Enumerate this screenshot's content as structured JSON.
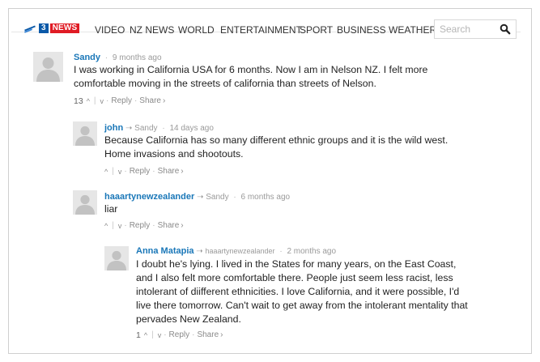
{
  "nav": {
    "logo_three": "3",
    "logo_news": "NEWS",
    "items": [
      "VIDEO",
      "NZ NEWS",
      "WORLD",
      "ENTERTAINMENT",
      "SPORT",
      "BUSINESS",
      "WEATHER"
    ],
    "search_placeholder": "Search"
  },
  "comments": [
    {
      "author": "Sandy",
      "reply_to": "",
      "time": "9 months ago",
      "lines": [
        "I was working in California USA for 6 months. Now I am in Nelson NZ. I felt more",
        "comfortable moving in the streets of california than streets of Nelson."
      ],
      "votes": "13",
      "reply_label": "Reply",
      "share_label": "Share"
    },
    {
      "author": "john",
      "reply_to": "Sandy",
      "time": "14 days ago",
      "lines": [
        "Because California has so many different ethnic groups and it is the wild west.",
        "Home invasions and shootouts."
      ],
      "votes": "",
      "reply_label": "Reply",
      "share_label": "Share"
    },
    {
      "author": "haaartynewzealander",
      "reply_to": "Sandy",
      "time": "6 months ago",
      "lines": [
        "liar"
      ],
      "votes": "",
      "reply_label": "Reply",
      "share_label": "Share"
    },
    {
      "author": "Anna Matapia",
      "reply_to": "haaartynewzealander",
      "time": "2 months ago",
      "lines": [
        "I doubt he's lying. I lived in the States for many years, on the East Coast,",
        "and I also felt more comfortable there. People just seem less racist, less",
        "intolerant of diifferent ethnicities. I love California, and it were possible, I'd",
        "live there tomorrow. Can't wait to get away from the intolerant mentality that",
        "pervades New Zealand."
      ],
      "votes": "1",
      "reply_label": "Reply",
      "share_label": "Share"
    }
  ],
  "icons": {
    "search": "search-icon",
    "avatar": "avatar-icon",
    "reply_arrow": "reply-arrow-icon",
    "upvote": "upvote-icon",
    "downvote": "downvote-icon"
  },
  "colors": {
    "author": "#1a77b8",
    "brand_blue": "#0b59a8",
    "brand_red": "#e01b24"
  }
}
